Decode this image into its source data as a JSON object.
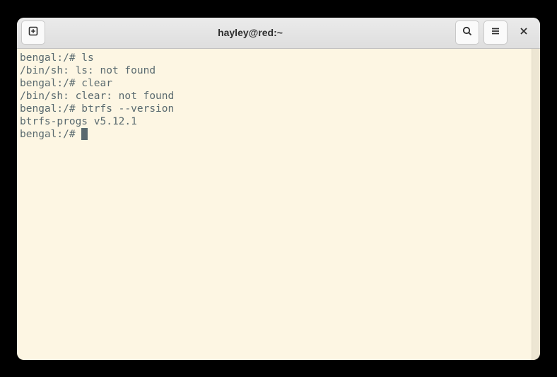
{
  "window": {
    "title": "hayley@red:~"
  },
  "terminal": {
    "lines": [
      "bengal:/# ls",
      "/bin/sh: ls: not found",
      "bengal:/# clear",
      "/bin/sh: clear: not found",
      "bengal:/# btrfs --version",
      "btrfs-progs v5.12.1"
    ],
    "prompt": "bengal:/# "
  }
}
